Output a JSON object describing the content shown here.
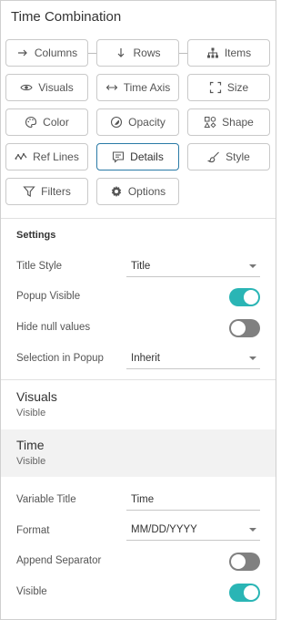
{
  "panel": {
    "title": "Time Combination"
  },
  "toolbar": {
    "columns": "Columns",
    "rows": "Rows",
    "items": "Items",
    "visuals": "Visuals",
    "time_axis": "Time Axis",
    "size": "Size",
    "color": "Color",
    "opacity": "Opacity",
    "shape": "Shape",
    "ref_lines": "Ref Lines",
    "details": "Details",
    "style": "Style",
    "filters": "Filters",
    "options": "Options"
  },
  "settings": {
    "heading": "Settings",
    "title_style_label": "Title Style",
    "title_style_value": "Title",
    "popup_visible_label": "Popup Visible",
    "popup_visible": true,
    "hide_null_label": "Hide null values",
    "hide_null": false,
    "selection_popup_label": "Selection in Popup",
    "selection_popup_value": "Inherit"
  },
  "groups": {
    "visuals_title": "Visuals",
    "visuals_sub": "Visible",
    "time_title": "Time",
    "time_sub": "Visible"
  },
  "time_settings": {
    "variable_title_label": "Variable Title",
    "variable_title_value": "Time",
    "format_label": "Format",
    "format_value": "MM/DD/YYYY",
    "append_separator_label": "Append Separator",
    "append_separator": false,
    "visible_label": "Visible",
    "visible": true
  },
  "colors": {
    "accent": "#2ab5b5",
    "active_border": "#2a7aa6",
    "toggle_off": "#808080"
  }
}
